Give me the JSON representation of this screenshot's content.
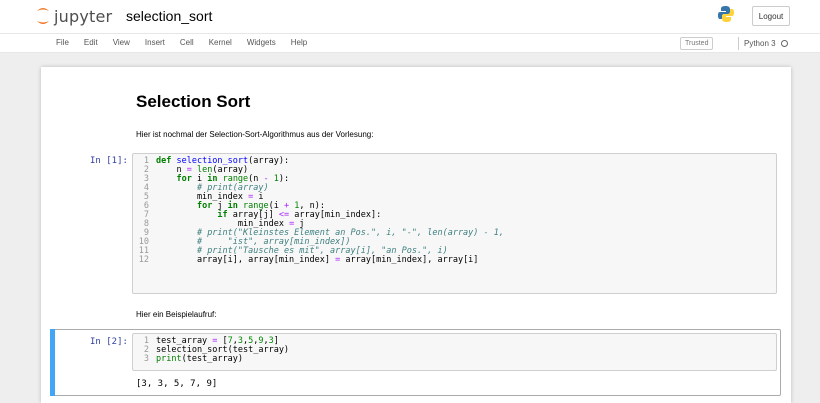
{
  "header": {
    "logo_text": "jupyter",
    "notebook_name": "selection_sort",
    "logout_label": "Logout"
  },
  "menu": {
    "items": [
      "File",
      "Edit",
      "View",
      "Insert",
      "Cell",
      "Kernel",
      "Widgets",
      "Help"
    ],
    "trusted_label": "Trusted",
    "kernel_name": "Python 3"
  },
  "cells": {
    "title": "Selection Sort",
    "intro_text": "Hier ist nochmal der Selection-Sort-Algorithmus aus der Vorlesung:",
    "cell1_prompt": "In [1]:",
    "cell1_lines": [
      "def selection_sort(array):",
      "    n = len(array)",
      "    for i in range(n - 1):",
      "        # print(array)",
      "        min_index = i",
      "        for j in range(i + 1, n):",
      "            if array[j] <= array[min_index]:",
      "                min_index = j",
      "        # print(\"Kleinstes Element an Pos.\", i, \"-\", len(array) - 1,",
      "        #     \"ist\", array[min_index])",
      "        # print(\"Tausche es mit\", array[i], \"an Pos.\", i)",
      "        array[i], array[min_index] = array[min_index], array[i]"
    ],
    "example_text": "Hier ein Beispielaufruf:",
    "cell2_prompt": "In [2]:",
    "cell2_lines": [
      "test_array = [7,3,5,9,3]",
      "selection_sort(test_array)",
      "print(test_array)"
    ],
    "cell2_output": "[3, 3, 5, 7, 9]"
  },
  "colors": {
    "keyword": "#008000",
    "function_name": "#0000ff",
    "comment": "#408080",
    "operator": "#aa22ff",
    "prompt": "#303f9f",
    "selected_cell_bar": "#42a5f5"
  }
}
